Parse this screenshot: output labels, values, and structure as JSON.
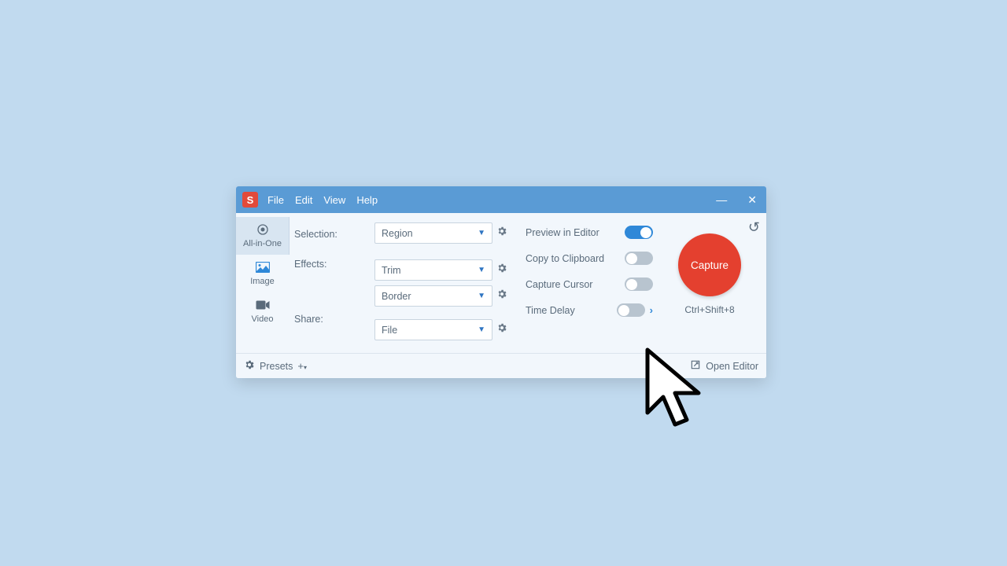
{
  "app_logo_letter": "S",
  "menu": {
    "file": "File",
    "edit": "Edit",
    "view": "View",
    "help": "Help"
  },
  "tabs": {
    "all": "All-in-One",
    "image": "Image",
    "video": "Video"
  },
  "labels": {
    "selection": "Selection:",
    "effects": "Effects:",
    "share": "Share:"
  },
  "dropdowns": {
    "selection": "Region",
    "effect1": "Trim",
    "effect2": "Border",
    "share": "File"
  },
  "toggles": {
    "preview": "Preview in Editor",
    "clipboard": "Copy to Clipboard",
    "cursor": "Capture Cursor",
    "delay": "Time Delay"
  },
  "capture": {
    "label": "Capture",
    "hotkey": "Ctrl+Shift+8"
  },
  "footer": {
    "presets": "Presets",
    "open_editor": "Open Editor"
  }
}
